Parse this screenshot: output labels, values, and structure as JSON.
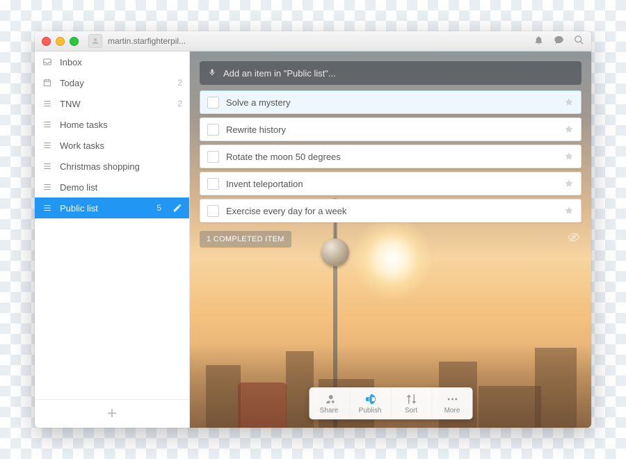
{
  "titlebar": {
    "username": "martin.starfighterpil..."
  },
  "sidebar": {
    "items": [
      {
        "icon": "inbox",
        "label": "Inbox",
        "count": null
      },
      {
        "icon": "today",
        "label": "Today",
        "count": "2"
      },
      {
        "icon": "list",
        "label": "TNW",
        "count": "2"
      },
      {
        "icon": "list",
        "label": "Home tasks",
        "count": null
      },
      {
        "icon": "list",
        "label": "Work tasks",
        "count": null
      },
      {
        "icon": "list",
        "label": "Christmas shopping",
        "count": null
      },
      {
        "icon": "list",
        "label": "Demo list",
        "count": null
      },
      {
        "icon": "list",
        "label": "Public list",
        "count": "5",
        "active": true
      }
    ],
    "add_label": "+"
  },
  "main": {
    "add_placeholder": "Add an item in \"Public list\"...",
    "tasks": [
      {
        "title": "Solve a mystery",
        "selected": true
      },
      {
        "title": "Rewrite history"
      },
      {
        "title": "Rotate the moon 50 degrees"
      },
      {
        "title": "Invent teleportation"
      },
      {
        "title": "Exercise every day for a week"
      }
    ],
    "completed_label": "1 COMPLETED ITEM"
  },
  "actions": {
    "share": "Share",
    "publish": "Publish",
    "sort": "Sort",
    "more": "More"
  }
}
